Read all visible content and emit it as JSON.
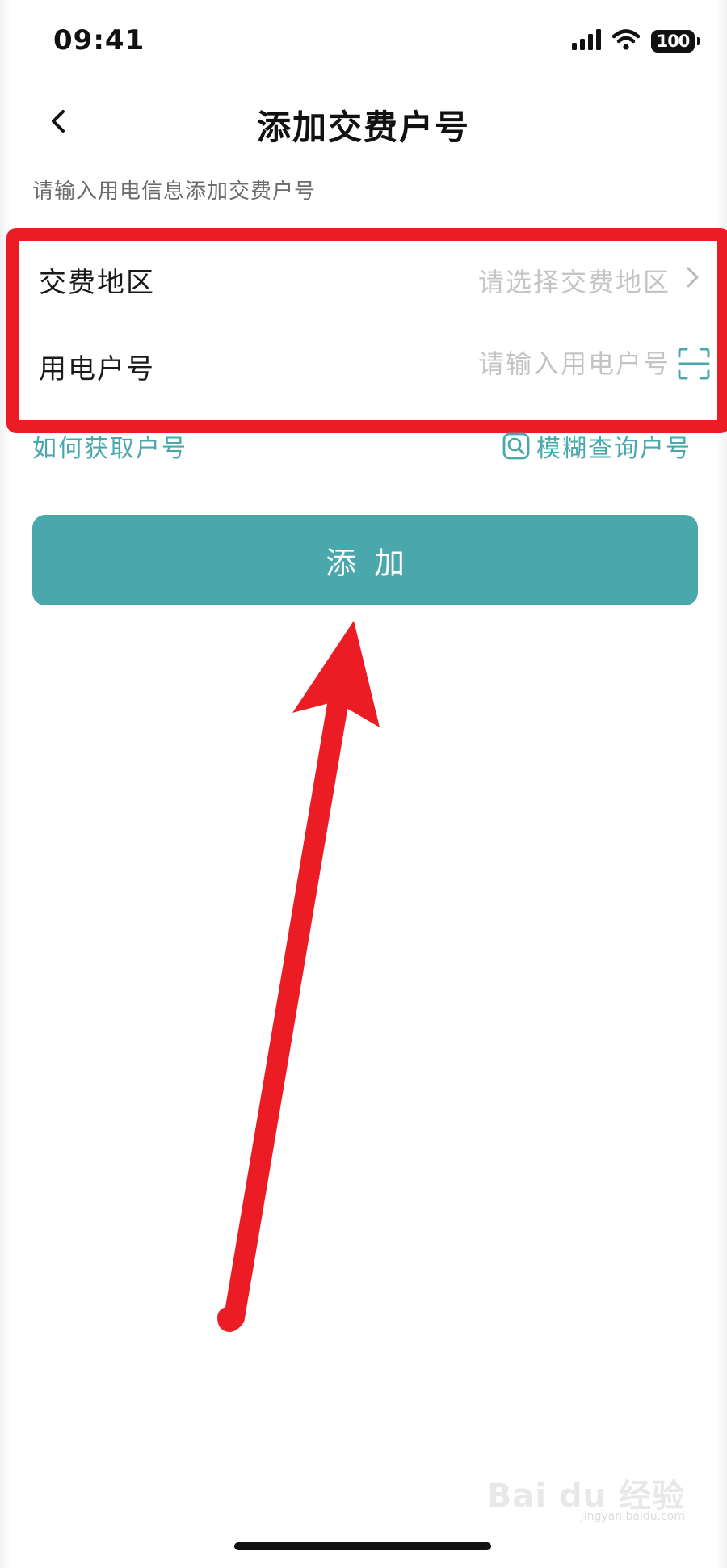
{
  "status_bar": {
    "time": "09:41",
    "battery": "100",
    "icons": [
      "signal-icon",
      "wifi-icon",
      "battery-icon"
    ]
  },
  "nav": {
    "back_icon": "chevron-left-icon",
    "title": "添加交费户号"
  },
  "hint": "请输入用电信息添加交费户号",
  "form": {
    "region": {
      "label": "交费地区",
      "placeholder": "请选择交费地区",
      "icon": "chevron-right-icon"
    },
    "account": {
      "label": "用电户号",
      "placeholder": "请输入用电户号",
      "icon": "scan-icon"
    }
  },
  "links": {
    "how_to_get": "如何获取户号",
    "fuzzy_search": "模糊查询户号",
    "fuzzy_search_icon": "search-icon"
  },
  "add_button": {
    "label": "添加"
  },
  "watermark": {
    "logo": "Bai du 经验",
    "sub": "jingyan.baidu.com"
  },
  "colors": {
    "accent": "#4aa8ad",
    "annotation_red": "#ec1c24",
    "placeholder": "#c4c4c4",
    "hint": "#6b6b6b"
  }
}
